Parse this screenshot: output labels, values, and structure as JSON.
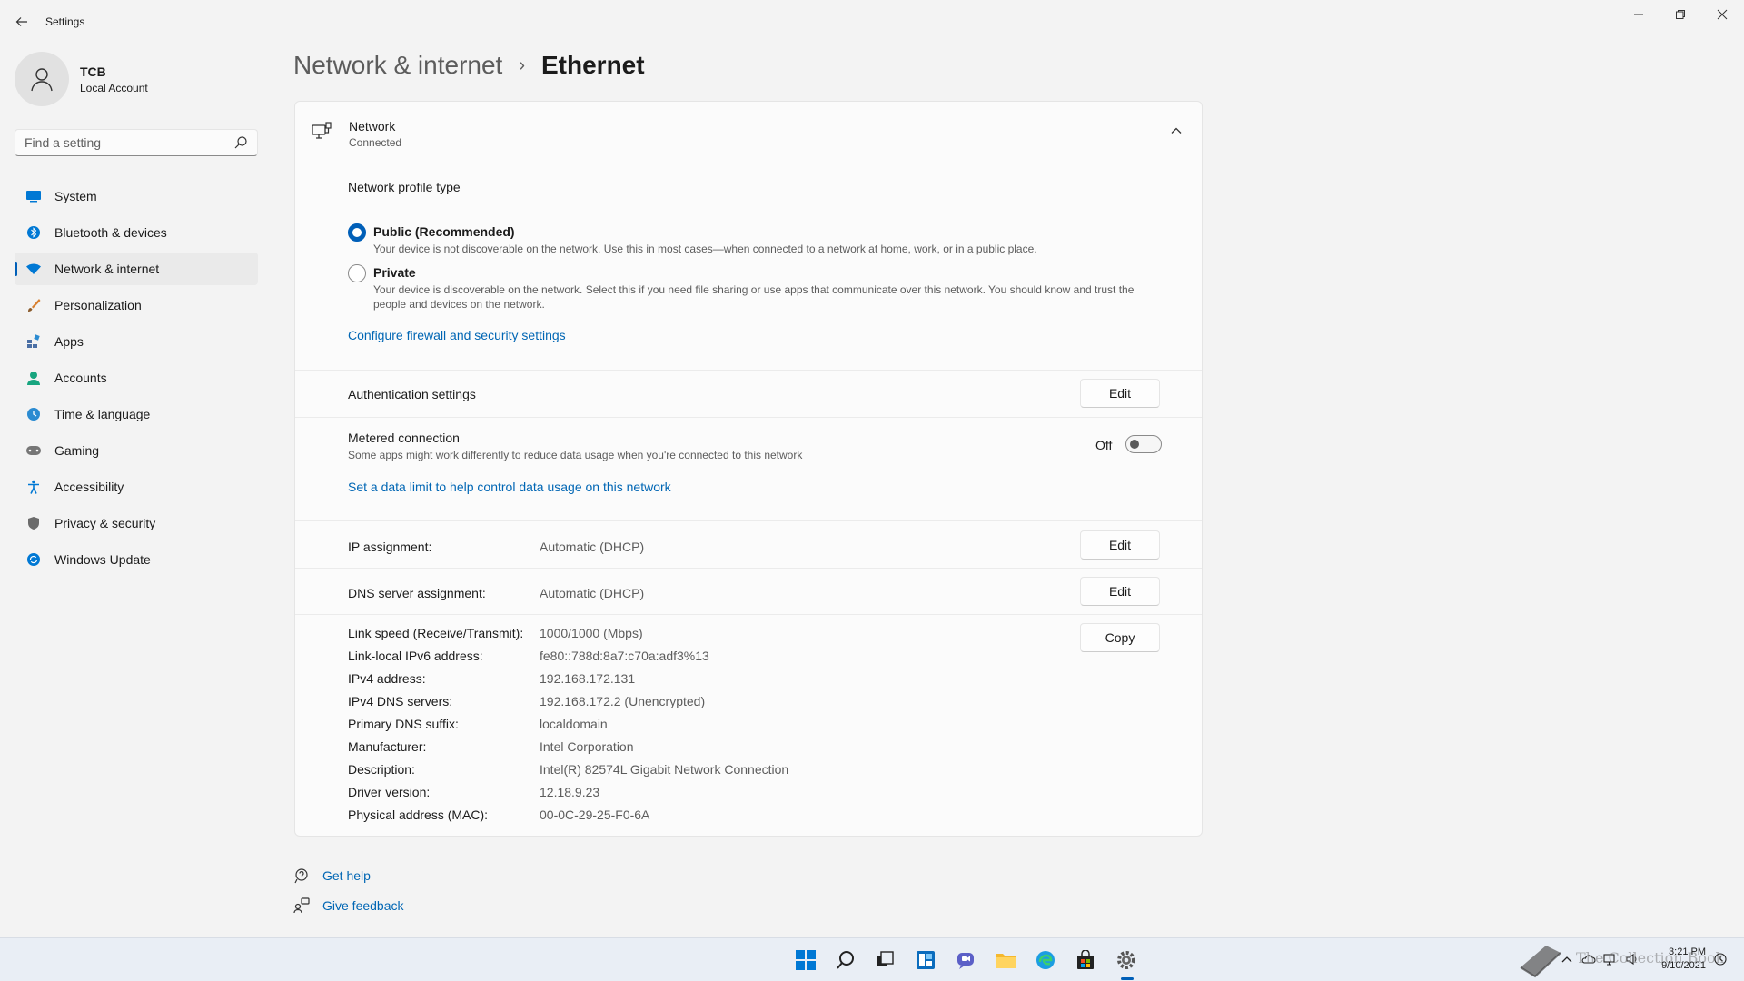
{
  "app": {
    "title": "Settings"
  },
  "profile": {
    "name": "TCB",
    "account_type": "Local Account"
  },
  "search": {
    "placeholder": "Find a setting"
  },
  "sidebar": {
    "items": [
      {
        "label": "System",
        "icon": "system-icon",
        "color": "#0078d4"
      },
      {
        "label": "Bluetooth & devices",
        "icon": "bluetooth-icon",
        "color": "#0078d4"
      },
      {
        "label": "Network & internet",
        "icon": "wifi-icon",
        "color": "#0078d4",
        "active": true
      },
      {
        "label": "Personalization",
        "icon": "brush-icon",
        "color": "#d87f2f"
      },
      {
        "label": "Apps",
        "icon": "apps-icon",
        "color": "#4a6fa5"
      },
      {
        "label": "Accounts",
        "icon": "person-icon",
        "color": "#17a57f"
      },
      {
        "label": "Time & language",
        "icon": "globe-clock-icon",
        "color": "#2b8bd1"
      },
      {
        "label": "Gaming",
        "icon": "gamepad-icon",
        "color": "#767676"
      },
      {
        "label": "Accessibility",
        "icon": "accessibility-icon",
        "color": "#0078d4"
      },
      {
        "label": "Privacy & security",
        "icon": "shield-icon",
        "color": "#6b6b6b"
      },
      {
        "label": "Windows Update",
        "icon": "update-icon",
        "color": "#0078d4"
      }
    ]
  },
  "breadcrumb": {
    "parent": "Network & internet",
    "separator": "›",
    "current": "Ethernet"
  },
  "network": {
    "title": "Network",
    "status": "Connected",
    "profile_type_label": "Network profile type",
    "options": [
      {
        "title": "Public (Recommended)",
        "desc": "Your device is not discoverable on the network. Use this in most cases—when connected to a network at home, work, or in a public place.",
        "checked": true
      },
      {
        "title": "Private",
        "desc": "Your device is discoverable on the network. Select this if you need file sharing or use apps that communicate over this network. You should know and trust the people and devices on the network.",
        "checked": false
      }
    ],
    "firewall_link": "Configure firewall and security settings",
    "auth_label": "Authentication settings",
    "edit_label": "Edit",
    "metered": {
      "title": "Metered connection",
      "desc": "Some apps might work differently to reduce data usage when you're connected to this network",
      "state": "Off"
    },
    "data_limit_link": "Set a data limit to help control data usage on this network",
    "ip_assignment": {
      "label": "IP assignment:",
      "value": "Automatic (DHCP)"
    },
    "dns_assignment": {
      "label": "DNS server assignment:",
      "value": "Automatic (DHCP)"
    },
    "copy_label": "Copy",
    "properties": [
      {
        "label": "Link speed (Receive/Transmit):",
        "value": "1000/1000 (Mbps)"
      },
      {
        "label": "Link-local IPv6 address:",
        "value": "fe80::788d:8a7:c70a:adf3%13"
      },
      {
        "label": "IPv4 address:",
        "value": "192.168.172.131"
      },
      {
        "label": "IPv4 DNS servers:",
        "value": "192.168.172.2 (Unencrypted)"
      },
      {
        "label": "Primary DNS suffix:",
        "value": "localdomain"
      },
      {
        "label": "Manufacturer:",
        "value": "Intel Corporation"
      },
      {
        "label": "Description:",
        "value": "Intel(R) 82574L Gigabit Network Connection"
      },
      {
        "label": "Driver version:",
        "value": "12.18.9.23"
      },
      {
        "label": "Physical address (MAC):",
        "value": "00-0C-29-25-F0-6A"
      }
    ]
  },
  "help": {
    "get_help": "Get help",
    "feedback": "Give feedback"
  },
  "taskbar": {
    "time": "3:21 PM",
    "date": "9/10/2021",
    "watermark": "The Collection Book",
    "accent": "#005fb8"
  }
}
